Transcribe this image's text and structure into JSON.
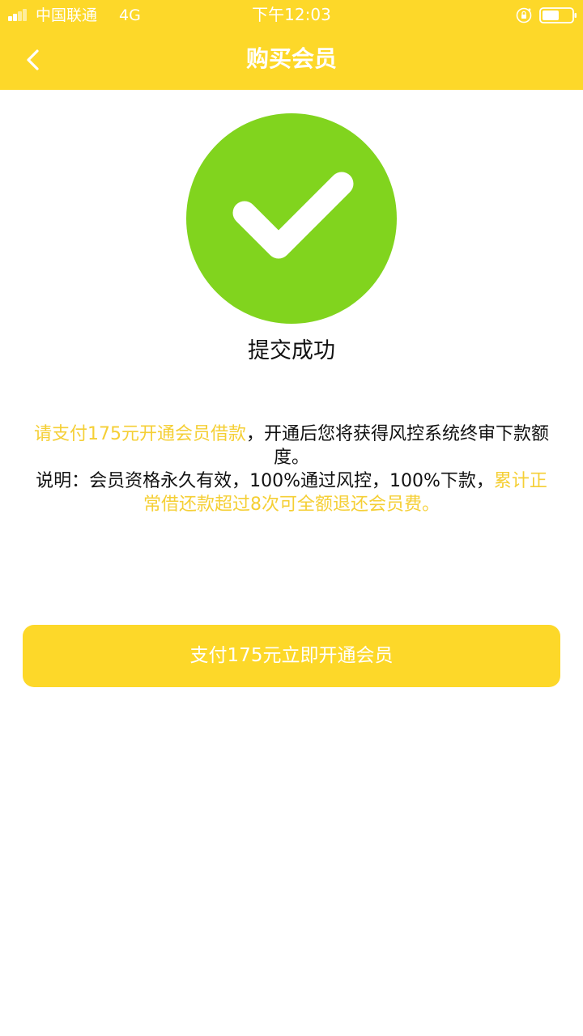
{
  "status_bar": {
    "carrier": "中国联通",
    "network": "4G",
    "time": "下午12:03"
  },
  "nav": {
    "title": "购买会员",
    "back_icon": "chevron-left-icon"
  },
  "success": {
    "icon": "check-circle-icon",
    "message": "提交成功"
  },
  "notice": {
    "line1_highlight": "请支付175元开通会员借款",
    "line1_rest": "，开通后您将获得风控系统终审下款额度。",
    "line2_plain": "说明：会员资格永久有效，100%通过风控，100%下款，",
    "line2_highlight": "累计正常借还款超过8次可全额退还会员费。"
  },
  "pay_button": {
    "label": "支付175元立即开通会员"
  },
  "colors": {
    "brand": "#fdd829",
    "highlight_text": "#f5cf35",
    "success_green": "#81d41e"
  }
}
